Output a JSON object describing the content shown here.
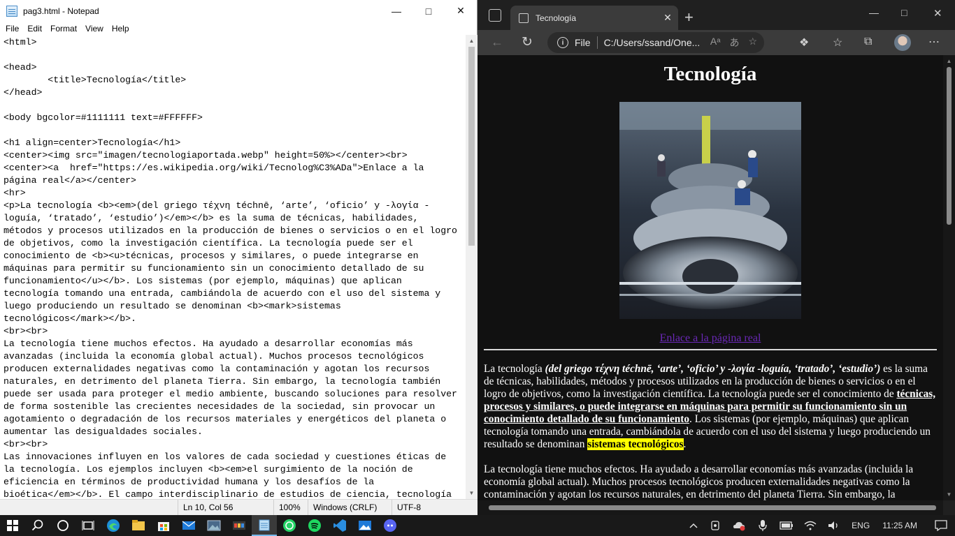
{
  "notepad": {
    "title": "pag3.html - Notepad",
    "menu": [
      "File",
      "Edit",
      "Format",
      "View",
      "Help"
    ],
    "content": "<html>\n\n<head>\n        <title>Tecnología</title>\n</head>\n\n<body bgcolor=#1111111 text=#FFFFFF>\n\n<h1 align=center>Tecnología</h1>\n<center><img src=\"imagen/tecnologiaportada.webp\" height=50%></center><br>\n<center><a  href=\"https://es.wikipedia.org/wiki/Tecnolog%C3%ADa\">Enlace a la\npágina real</a></center>\n<hr>\n<p>La tecnología <b><em>(del griego τέχνη téchnē, ‘arte’, ‘oficio’ y -λογία -\nloguía, ‘tratado’, ‘estudio’)</em></b> es la suma de técnicas, habilidades,\nmétodos y procesos utilizados en la producción de bienes o servicios o en el logro\nde objetivos, como la investigación científica. La tecnología puede ser el\nconocimiento de <b><u>técnicas, procesos y similares, o puede integrarse en\nmáquinas para permitir su funcionamiento sin un conocimiento detallado de su\nfuncionamiento</u></b>. Los sistemas (por ejemplo, máquinas) que aplican\ntecnología tomando una entrada, cambiándola de acuerdo con el uso del sistema y\nluego produciendo un resultado se denominan <b><mark>sistemas\ntecnológicos</mark></b>.\n<br><br>\nLa tecnología tiene muchos efectos. Ha ayudado a desarrollar economías más\navanzadas (incluida la economía global actual). Muchos procesos tecnológicos\nproducen externalidades negativas como la contaminación y agotan los recursos\nnaturales, en detrimento del planeta Tierra. Sin embargo, la tecnología también\npuede ser usada para proteger el medio ambiente, buscando soluciones para resolver\nde forma sostenible las crecientes necesidades de la sociedad, sin provocar un\nagotamiento o degradación de los recursos materiales y energéticos del planeta o\naumentar las desigualdades sociales.\n<br><br>\nLas innovaciones influyen en los valores de cada sociedad y cuestiones éticas de\nla tecnología. Los ejemplos incluyen <b><em>el surgimiento de la noción de\neficiencia en términos de productividad humana y los desafíos de la\nbioética</em></b>. El campo interdisciplinario de estudios de ciencia, tecnología",
    "status": {
      "position": "Ln 10, Col 56",
      "zoom": "100%",
      "line_ending": "Windows (CRLF)",
      "encoding": "UTF-8"
    }
  },
  "browser": {
    "tab_title": "Tecnología",
    "address_protocol": "File",
    "address_url": "C:/Users/ssand/One...",
    "page": {
      "heading": "Tecnología",
      "link": "Enlace a la página real",
      "p1_intro": "La tecnología ",
      "p1_em": "(del griego τέχνη téchnē, ‘arte’, ‘oficio’ y -λογία -loguía, ‘tratado’, ‘estudio’)",
      "p1_mid": " es la suma de técnicas, habilidades, métodos y procesos utilizados en la producción de bienes o servicios o en el logro de objetivos, como la investigación científica. La tecnología puede ser el conocimiento de ",
      "p1_u": "técnicas, procesos y similares, o puede integrarse en máquinas para permitir su funcionamiento sin un conocimiento detallado de su funcionamiento",
      "p1_after": ". Los sistemas (por ejemplo, máquinas) que aplican tecnología tomando una entrada, cambiándola de acuerdo con el uso del sistema y luego produciendo un resultado se denominan ",
      "p1_mark": "sistemas tecnológicos",
      "p1_end": ".",
      "p2": "La tecnología tiene muchos efectos. Ha ayudado a desarrollar economías más avanzadas (incluida la economía global actual). Muchos procesos tecnológicos producen externalidades negativas como la contaminación y agotan los recursos naturales, en detrimento del planeta Tierra. Sin embargo, la tecnología también puede ser usada para proteger el medio ambiente."
    }
  },
  "taskbar": {
    "language": "ENG",
    "time": "11:25 AM"
  },
  "colors": {
    "page_bg": "#111111",
    "link": "#6b28b8",
    "mark": "#ffff00"
  }
}
